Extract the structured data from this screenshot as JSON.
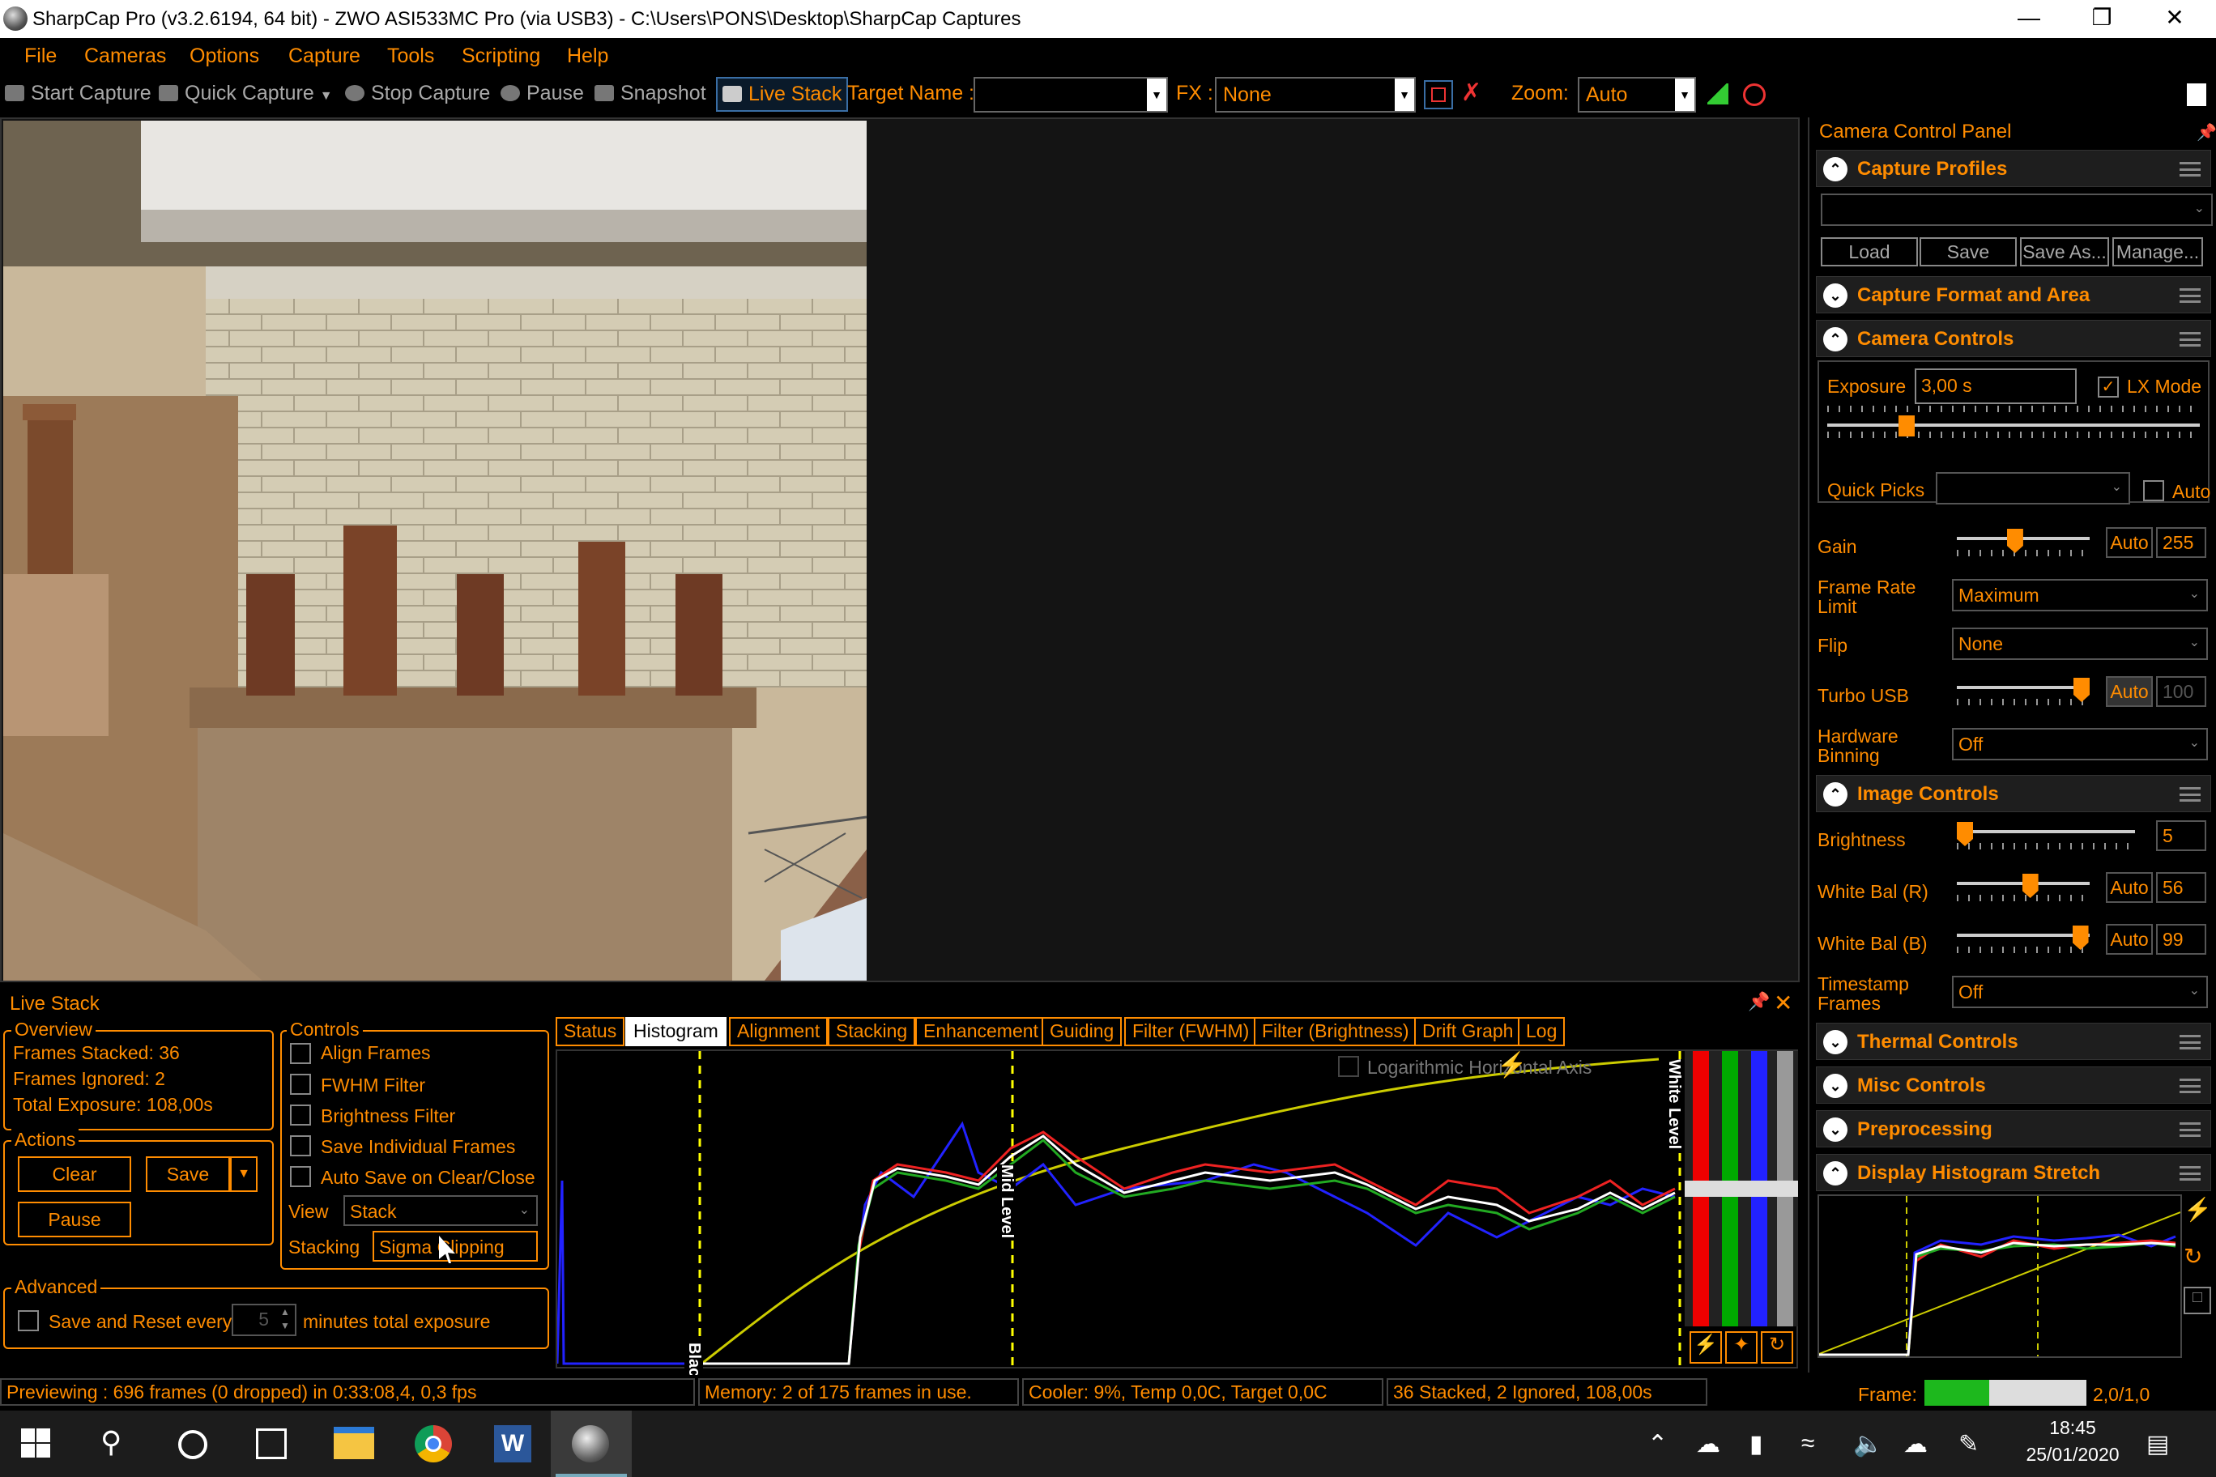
{
  "window": {
    "title": "SharpCap Pro (v3.2.6194, 64 bit) - ZWO ASI533MC Pro (via USB3) - C:\\Users\\PONS\\Desktop\\SharpCap Captures"
  },
  "menu": [
    "File",
    "Cameras",
    "Options",
    "Capture",
    "Tools",
    "Scripting",
    "Help"
  ],
  "toolbar": {
    "start_capture": "Start Capture",
    "quick_capture": "Quick Capture",
    "stop_capture": "Stop Capture",
    "pause": "Pause",
    "snapshot": "Snapshot",
    "live_stack": "Live Stack",
    "target_name_label": "Target Name :",
    "target_name_value": "",
    "fx_label": "FX :",
    "fx_value": "None",
    "zoom_label": "Zoom:",
    "zoom_value": "Auto"
  },
  "ccp": {
    "title": "Camera Control Panel",
    "capture_profiles": {
      "heading": "Capture Profiles",
      "selected": "",
      "load": "Load",
      "save": "Save",
      "save_as": "Save As...",
      "manage": "Manage..."
    },
    "capture_format": {
      "heading": "Capture Format and Area"
    },
    "camera_controls": {
      "heading": "Camera Controls",
      "exposure_label": "Exposure",
      "exposure_value": "3,00 s",
      "lx_mode_label": "LX Mode",
      "lx_mode_checked": true,
      "exposure_slider": 0.2,
      "quick_picks_label": "Quick Picks",
      "quick_picks_value": "",
      "quick_picks_auto": "Auto",
      "gain_label": "Gain",
      "gain_auto": "Auto",
      "gain_value": "255",
      "gain_slider": 0.43,
      "frame_rate_label": "Frame Rate Limit",
      "frame_rate_value": "Maximum",
      "flip_label": "Flip",
      "flip_value": "None",
      "turbo_label": "Turbo USB",
      "turbo_auto": "Auto",
      "turbo_value": "100",
      "turbo_slider": 1.0,
      "binning_label": "Hardware Binning",
      "binning_value": "Off"
    },
    "image_controls": {
      "heading": "Image Controls",
      "brightness_label": "Brightness",
      "brightness_value": "5",
      "brightness_slider": 0.0,
      "wb_r_label": "White Bal (R)",
      "wb_r_auto": "Auto",
      "wb_r_value": "56",
      "wb_r_slider": 0.56,
      "wb_b_label": "White Bal (B)",
      "wb_b_auto": "Auto",
      "wb_b_value": "99",
      "wb_b_slider": 0.99,
      "timestamp_label": "Timestamp Frames",
      "timestamp_value": "Off"
    },
    "thermal": {
      "heading": "Thermal Controls"
    },
    "misc": {
      "heading": "Misc Controls"
    },
    "preprocessing": {
      "heading": "Preprocessing"
    },
    "stretch": {
      "heading": "Display Histogram Stretch"
    }
  },
  "livestack": {
    "title": "Live Stack",
    "overview": {
      "heading": "Overview",
      "frames_stacked": "Frames Stacked: 36",
      "frames_ignored": "Frames Ignored:  2",
      "total_exposure": "Total Exposure:   108,00s"
    },
    "actions": {
      "heading": "Actions",
      "clear": "Clear",
      "save": "Save",
      "pause": "Pause"
    },
    "controls": {
      "heading": "Controls",
      "align_frames": "Align Frames",
      "fwhm_filter": "FWHM Filter",
      "brightness_filter": "Brightness Filter",
      "save_individual": "Save Individual Frames",
      "auto_save": "Auto Save on Clear/Close",
      "view_label": "View",
      "view_value": "Stack",
      "stacking_label": "Stacking",
      "stacking_value": "Sigma Clipping"
    },
    "advanced": {
      "heading": "Advanced",
      "save_reset": "Save and Reset every",
      "minutes_value": "5",
      "minutes_suffix": "minutes total exposure"
    },
    "tabs": [
      "Status",
      "Histogram",
      "Alignment",
      "Stacking",
      "Enhancement",
      "Guiding",
      "Filter (FWHM)",
      "Filter (Brightness)",
      "Drift Graph",
      "Log"
    ],
    "active_tab": "Histogram",
    "histogram": {
      "log_axis_label": "Logarithmic Horizontal Axis",
      "black_level": "Black Level",
      "mid_level": "Mid Level",
      "white_level": "White Level"
    }
  },
  "statusbar": {
    "preview": "Previewing : 696 frames (0 dropped) in 0:33:08,4, 0,3 fps",
    "memory": "Memory: 2 of 175 frames in use.",
    "cooler": "Cooler: 9%, Temp 0,0C, Target 0,0C",
    "stacked": "36 Stacked, 2 Ignored, 108,00s",
    "frame_label": "Frame:",
    "frame_value": "2,0/1,0",
    "frame_progress": 0.4
  },
  "taskbar": {
    "time": "18:45",
    "date": "25/01/2020"
  },
  "colors": {
    "accent": "#ff8c00",
    "background": "#000000"
  }
}
